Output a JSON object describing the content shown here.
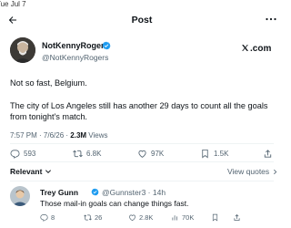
{
  "status_bar": {
    "date": "Tue Jul 7"
  },
  "header": {
    "title": "Post",
    "back_icon": "arrow-left-icon",
    "more_icon": "more-horizontal-icon"
  },
  "author": {
    "name": "NotKennyRogers",
    "handle": "@NotKennyRogers",
    "verified": true,
    "link_badge": ".com"
  },
  "tweet": {
    "line1": "Not so fast, Belgium.",
    "line2": "The city of Los Angeles still has another 29 days to count all the goals",
    "line3": "from tonight's match."
  },
  "meta": {
    "time": "7:57 PM",
    "date": "7/6/26",
    "views_count": "2.3M",
    "views_label": "Views"
  },
  "actions": {
    "replies": "593",
    "reposts": "6.8K",
    "likes": "97K",
    "bookmarks": "1.5K"
  },
  "sort": {
    "relevant_label": "Relevant",
    "view_quotes_label": "View quotes"
  },
  "reply": {
    "name": "Trey Gunn",
    "handle": "@Gunnster3 · 14h",
    "text": "Those mail-in goals can change things fast.",
    "replies": "8",
    "reposts": "26",
    "likes": "2.8K",
    "views": "70K"
  },
  "colors": {
    "accent": "#1d9bf0",
    "text": "#0f1419",
    "muted": "#536471"
  }
}
